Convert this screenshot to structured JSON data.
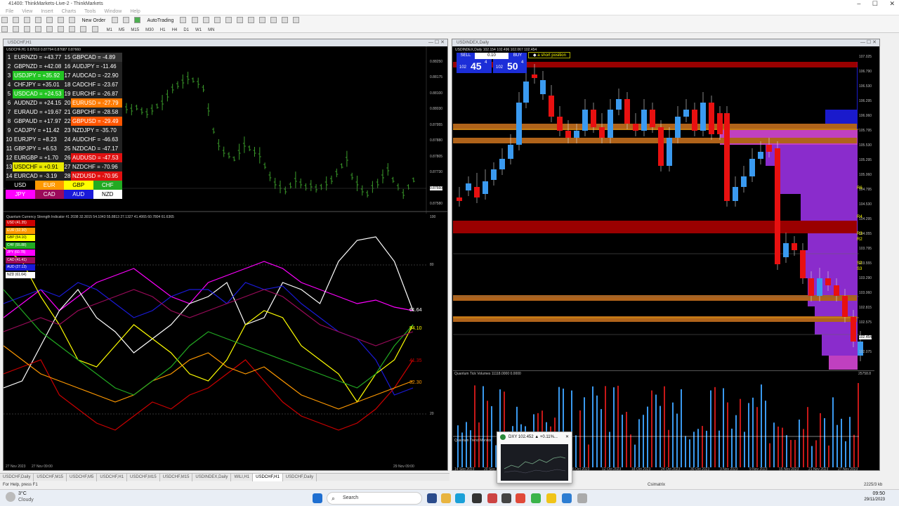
{
  "app": {
    "title": "41400: ThinkMarkets-Live-2 - ThinkMarkets",
    "menu": [
      "File",
      "View",
      "Insert",
      "Charts",
      "Tools",
      "Window",
      "Help"
    ],
    "new_order": "New Order",
    "autotrading": "AutoTrading",
    "timeframes": [
      "M1",
      "M5",
      "M15",
      "M30",
      "H1",
      "H4",
      "D1",
      "W1",
      "MN"
    ]
  },
  "left_chart": {
    "window_title": "USDCHF,H1",
    "info": "USDCHF,H1  0.87810 0.87794 0.87687 0.87660",
    "price_labels": [
      "0.88250",
      "0.88175",
      "0.88100",
      "0.88030",
      "0.87955",
      "0.87880",
      "0.87805",
      "0.87730",
      "0.87660",
      "0.87580"
    ],
    "strength_rows": [
      {
        "n": "1",
        "left": "EURNZD = +43.77",
        "lc": "#222222",
        "n2": "15",
        "right": "GBPCAD = -4.89",
        "rc": "#333333"
      },
      {
        "n": "2",
        "left": "GBPNZD = +42.08",
        "lc": "#222222",
        "n2": "16",
        "right": "AUDJPY = -11.46",
        "rc": "#222222"
      },
      {
        "n": "3",
        "left": "USDJPY = +35.92",
        "lc": "#22c422",
        "n2": "17",
        "right": "AUDCAD = -22.90",
        "rc": "#222222"
      },
      {
        "n": "4",
        "left": "CHFJPY = +35.01",
        "lc": "#222222",
        "n2": "18",
        "right": "CADCHF = -23.67",
        "rc": "#222222"
      },
      {
        "n": "5",
        "left": "USDCAD = +24.53",
        "lc": "#22c422",
        "n2": "19",
        "right": "EURCHF = -26.87",
        "rc": "#222222"
      },
      {
        "n": "6",
        "left": "AUDNZD = +24.15",
        "lc": "#222222",
        "n2": "20",
        "right": "EURUSD = -27.79",
        "rc": "#ff7a00"
      },
      {
        "n": "7",
        "left": "EURAUD = +19.67",
        "lc": "#222222",
        "n2": "21",
        "right": "GBPCHF = -28.58",
        "rc": "#222222"
      },
      {
        "n": "8",
        "left": "GBPAUD = +17.97",
        "lc": "#222222",
        "n2": "22",
        "right": "GBPUSD = -29.49",
        "rc": "#ff5500"
      },
      {
        "n": "9",
        "left": "CADJPY = +11.42",
        "lc": "#222222",
        "n2": "23",
        "right": "NZDJPY = -35.70",
        "rc": "#222222"
      },
      {
        "n": "10",
        "left": "EURJPY = +8.23",
        "lc": "#222222",
        "n2": "24",
        "right": "AUDCHF = -46.63",
        "rc": "#222222"
      },
      {
        "n": "11",
        "left": "GBPJPY = +6.53",
        "lc": "#222222",
        "n2": "25",
        "right": "NZDCAD = -47.17",
        "rc": "#222222"
      },
      {
        "n": "12",
        "left": "EURGBP = +1.70",
        "lc": "#222222",
        "n2": "26",
        "right": "AUDUSD = -47.53",
        "rc": "#e01010"
      },
      {
        "n": "13",
        "left": "USDCHF = +0.91",
        "lc": "#e8e800",
        "n2": "27",
        "right": "NZDCHF = -70.96",
        "rc": "#222222"
      },
      {
        "n": "14",
        "left": "EURCAD = -3.19",
        "lc": "#222222",
        "n2": "28",
        "right": "NZDUSD = -70.95",
        "rc": "#e01010"
      }
    ],
    "currency_legend": [
      {
        "label": "USD",
        "bg": "#000000",
        "fg": "#ffffff"
      },
      {
        "label": "EUR",
        "bg": "#ff9900",
        "fg": "#ffffff"
      },
      {
        "label": "GBP",
        "bg": "#ffff00",
        "fg": "#000000"
      },
      {
        "label": "CHF",
        "bg": "#22aa22",
        "fg": "#ffffff"
      },
      {
        "label": "JPY",
        "bg": "#ff00ff",
        "fg": "#ffffff"
      },
      {
        "label": "CAD",
        "bg": "#9b0a5a",
        "fg": "#ffffff"
      },
      {
        "label": "AUD",
        "bg": "#1a1ad8",
        "fg": "#ffffff"
      },
      {
        "label": "NZD",
        "bg": "#ffffff",
        "fg": "#000000"
      }
    ],
    "indicator_title": "Quantum Currency Strength Indicator #1 2038 32.3015 54.1043 55.8813 27.1327 41.4065 60.7804 61.6365",
    "indicator_levels": [
      "100",
      "80",
      "20"
    ],
    "indicator_labels": [
      {
        "label": "USD (41.35)",
        "bg": "#cc0000"
      },
      {
        "label": "EUR (32.30)",
        "bg": "#ff9900"
      },
      {
        "label": "GBP (54.10)",
        "bg": "#ffff00",
        "fg": "#000000"
      },
      {
        "label": "CHF (55.88)",
        "bg": "#22aa22"
      },
      {
        "label": "JPY (60.78)",
        "bg": "#ff00ff"
      },
      {
        "label": "CAD (41.41)",
        "bg": "#9b0a5a"
      },
      {
        "label": "AUD (27.13)",
        "bg": "#1a1ad8"
      },
      {
        "label": "NZD (61.64)",
        "bg": "#ffffff",
        "fg": "#000000"
      }
    ],
    "right_values": [
      "61.64",
      "54.10",
      "41.35",
      "32.30"
    ],
    "dates": [
      "27 Nov 2023",
      "27 Nov 09:00",
      "29 Nov 09:00"
    ]
  },
  "right_chart": {
    "window_title": "USDINDEX,Daily",
    "info": "USDINDEX,Daily  102.154 102.496 102.067 102.454",
    "sell_label": "SELL",
    "buy_label": "BUY",
    "lot": "0.10",
    "sell_price_small": "102",
    "sell_price_big": "45",
    "sell_price_sup": "4",
    "buy_price_small": "102",
    "buy_price_big": "50",
    "buy_price_sup": "4",
    "position_note": "a short position",
    "price_labels": [
      "107.025",
      "106.790",
      "106.530",
      "106.295",
      "106.060",
      "105.795",
      "105.530",
      "105.295",
      "105.060",
      "104.795",
      "104.530",
      "104.295",
      "104.055",
      "103.795",
      "103.555",
      "103.290",
      "103.060",
      "102.815",
      "102.575",
      "102.454",
      "102.075"
    ],
    "levels": [
      "R6",
      "R4",
      "R3",
      "R2",
      "S2",
      "S3"
    ],
    "volume_title": "Quantum Tick Volumes 11118.0000 0.0000",
    "volume_max": "25758.8",
    "trend_title": "Quantum Trend Monitor",
    "dates": [
      "14 Sep 2023",
      "20 Sep 2023",
      "26 Sep 2023",
      "2 Oct 2023",
      "6 Oct 2023",
      "12 Oct 2023",
      "18 Oct 2023",
      "24 Oct 2023",
      "30 Oct 2023",
      "3 Nov 2023",
      "9 Nov 2023",
      "15 Nov 2023",
      "21 Nov 2023",
      "27 Nov 2023"
    ]
  },
  "tabs": [
    "USDCHF,Daily",
    "USDCHF,M15",
    "USDCHF,M5",
    "USDCHF,H1",
    "USDCHF,M15",
    "USDCHF,M15",
    "USDINDEX,Daily",
    "WILI,H1",
    "USDCHF,H1",
    "USDCHF,Daily"
  ],
  "status": {
    "help": "For Help, press F1",
    "profile": "Csimatrix",
    "traffic": "2225/3 kb"
  },
  "popup": {
    "title": "DXY 102.452 ▲ +0.11%..."
  },
  "taskbar": {
    "weather_temp": "3°C",
    "weather_desc": "Cloudy",
    "search": "Search",
    "time": "09:50",
    "date": "29/11/2023"
  }
}
